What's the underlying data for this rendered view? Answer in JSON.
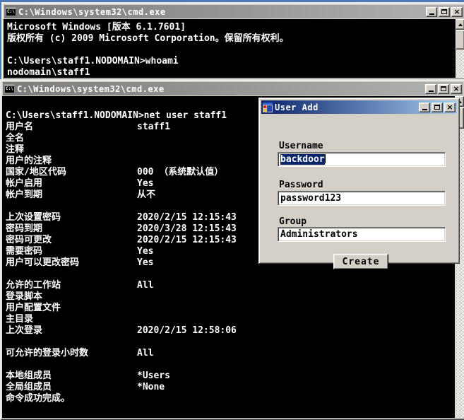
{
  "colors": {
    "desktop": "#4d7ab5",
    "active_title_from": "#0a246a",
    "active_title_to": "#a6caf0",
    "inactive_title": "#7b7b7b",
    "selection": "#0a246a",
    "terminal_bg": "#000000",
    "terminal_fg": "#ffffff"
  },
  "cmd_window_top": {
    "title": "C:\\Windows\\system32\\cmd.exe",
    "icon": "cmd-icon",
    "lines": [
      "Microsoft Windows [版本 6.1.7601]",
      "版权所有 (c) 2009 Microsoft Corporation。保留所有权利。",
      "",
      "C:\\Users\\staff1.NODOMAIN>whoami",
      "nodomain\\staff1"
    ]
  },
  "cmd_window_bottom": {
    "title": "C:\\Windows\\system32\\cmd.exe",
    "icon": "cmd-icon",
    "rows": [
      {
        "label": ""
      },
      {
        "label": "C:\\Users\\staff1.NODOMAIN>net user staff1"
      },
      {
        "label": "用户名",
        "value": "staff1"
      },
      {
        "label": "全名"
      },
      {
        "label": "注释"
      },
      {
        "label": "用户的注释"
      },
      {
        "label": "国家/地区代码",
        "value": "000 （系统默认值）"
      },
      {
        "label": "帐户启用",
        "value": "Yes"
      },
      {
        "label": "帐户到期",
        "value": "从不"
      },
      {
        "label": ""
      },
      {
        "label": "上次设置密码",
        "value": "2020/2/15 12:15:43"
      },
      {
        "label": "密码到期",
        "value": "2020/3/28 12:15:43"
      },
      {
        "label": "密码可更改",
        "value": "2020/2/15 12:15:43"
      },
      {
        "label": "需要密码",
        "value": "Yes"
      },
      {
        "label": "用户可以更改密码",
        "value": "Yes"
      },
      {
        "label": ""
      },
      {
        "label": "允许的工作站",
        "value": "All"
      },
      {
        "label": "登录脚本"
      },
      {
        "label": "用户配置文件"
      },
      {
        "label": "主目录"
      },
      {
        "label": "上次登录",
        "value": "2020/2/15 12:58:06"
      },
      {
        "label": ""
      },
      {
        "label": "可允许的登录小时数",
        "value": "All"
      },
      {
        "label": ""
      },
      {
        "label": "本地组成员",
        "value": "*Users"
      },
      {
        "label": "全局组成员",
        "value": "*None"
      },
      {
        "label": "命令成功完成。"
      }
    ]
  },
  "user_add_dialog": {
    "title": "User Add",
    "icon": "winform-icon",
    "username_label": "Username",
    "username_value": "backdoor",
    "password_label": "Password",
    "password_value": "password123",
    "group_label": "Group",
    "group_value": "Administrators",
    "create_button": "Create"
  }
}
